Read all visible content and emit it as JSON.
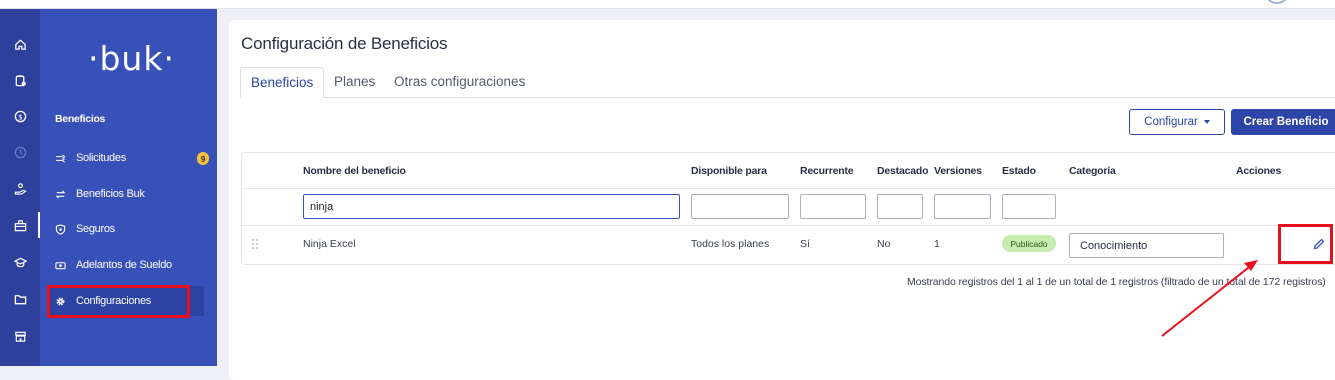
{
  "app": {
    "logo_text": "·buk·"
  },
  "rail": {
    "icons": [
      "home-icon",
      "clipboard-icon",
      "dollar-icon",
      "clock-icon",
      "hand-icon",
      "gift-icon",
      "graduation-icon",
      "folder-icon",
      "store-icon"
    ],
    "active": "gift-icon"
  },
  "sidebar": {
    "section_title": "Beneficios",
    "items": [
      {
        "label": "Solicitudes",
        "icon": "requests-icon",
        "badge": "9"
      },
      {
        "label": "Beneficios Buk",
        "icon": "swap-icon"
      },
      {
        "label": "Seguros",
        "icon": "shield-icon"
      },
      {
        "label": "Adelantos de Sueldo",
        "icon": "money-icon"
      },
      {
        "label": "Configuraciones",
        "icon": "gear-icon",
        "active": true
      }
    ]
  },
  "main": {
    "title": "Configuración de Beneficios",
    "tabs": [
      {
        "label": "Beneficios",
        "active": true
      },
      {
        "label": "Planes"
      },
      {
        "label": "Otras configuraciones"
      }
    ],
    "actions": {
      "configure_label": "Configurar",
      "create_label": "Crear Beneficio"
    }
  },
  "table": {
    "columns": [
      "Nombre del beneficio",
      "Disponible para",
      "Recurrente",
      "Destacado",
      "Versiones",
      "Estado",
      "Categoría",
      "Acciones"
    ],
    "filters": {
      "name": "ninja",
      "available": "",
      "recurrent": "",
      "featured": "",
      "versions": "",
      "status": ""
    },
    "rows": [
      {
        "name": "Ninja Excel",
        "available": "Todos los planes",
        "recurrent": "Sí",
        "featured": "No",
        "versions": "1",
        "status": "Publicado",
        "category": "Conocimiento"
      }
    ],
    "footer": "Mostrando registros del 1 al 1 de un total de 1 registros (filtrado de un total de 172 registros)"
  },
  "colors": {
    "sidebar": "#3751b8",
    "rail": "#2e3f9c",
    "primary": "#2e45a8",
    "highlight": "#e8101a",
    "published": "#c6ecb0"
  }
}
